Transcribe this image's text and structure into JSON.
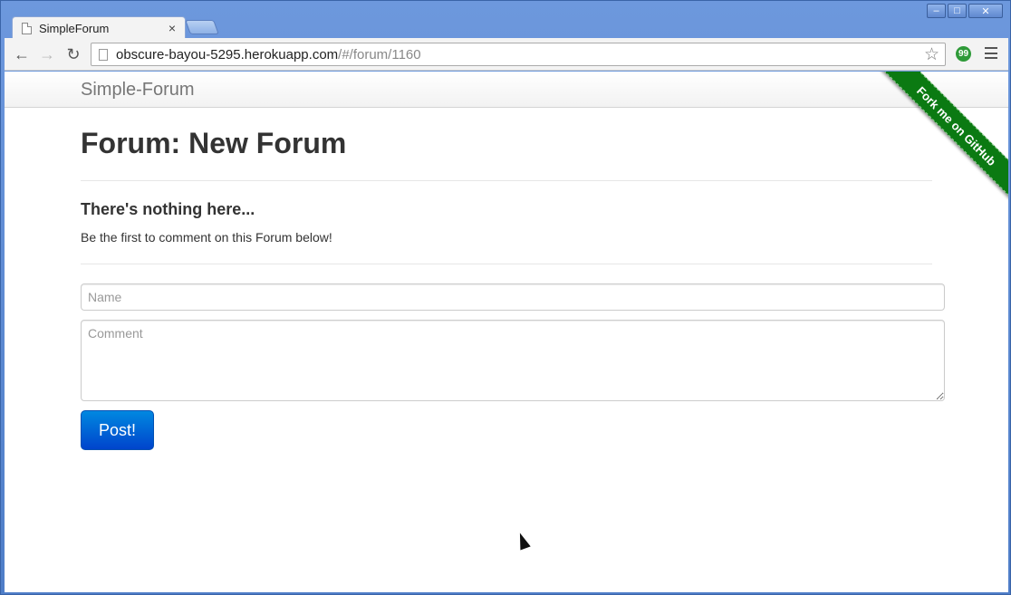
{
  "browser": {
    "tab_title": "SimpleForum",
    "tab_close_glyph": "×",
    "url_host": "obscure-bayou-5295.herokuapp.com",
    "url_path": "/#/forum/1160",
    "back_glyph": "←",
    "forward_glyph": "→",
    "reload_glyph": "↻",
    "star_glyph": "☆",
    "ext_glyph": "99",
    "window_controls": {
      "minimize": "–",
      "maximize": "□",
      "close": "✕"
    }
  },
  "navbar": {
    "brand": "Simple-Forum"
  },
  "ribbon": {
    "label": "Fork me on GitHub",
    "color": "#0b7a12"
  },
  "main": {
    "title": "Forum: New Forum",
    "empty_heading": "There's nothing here...",
    "empty_text": "Be the first to comment on this Forum below!"
  },
  "form": {
    "name_placeholder": "Name",
    "comment_placeholder": "Comment",
    "submit_label": "Post!",
    "submit_color": "#0055cc"
  }
}
